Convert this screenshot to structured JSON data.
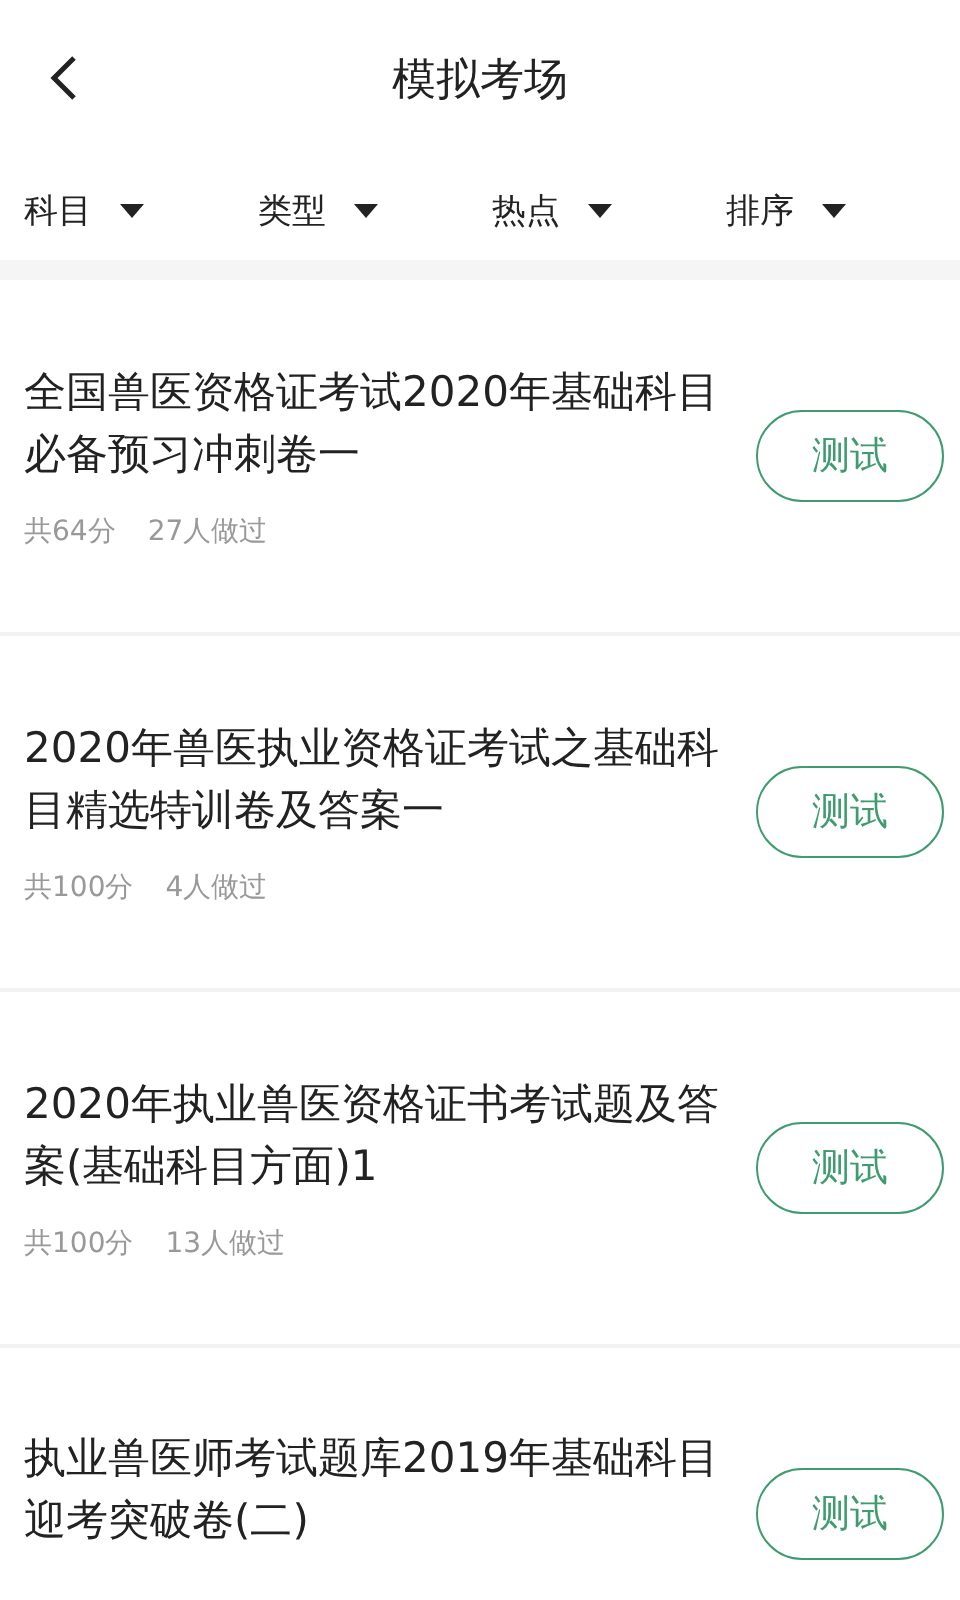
{
  "header": {
    "title": "模拟考场"
  },
  "filters": [
    {
      "label": "科目"
    },
    {
      "label": "类型"
    },
    {
      "label": "热点"
    },
    {
      "label": "排序"
    }
  ],
  "exams": [
    {
      "title": "全国兽医资格证考试2020年基础科目必备预习冲刺卷一",
      "score": "共64分",
      "takers": "27人做过",
      "button": "测试"
    },
    {
      "title": "2020年兽医执业资格证考试之基础科目精选特训卷及答案一",
      "score": "共100分",
      "takers": "4人做过",
      "button": "测试"
    },
    {
      "title": "2020年执业兽医资格证书考试题及答案(基础科目方面)1",
      "score": "共100分",
      "takers": "13人做过",
      "button": "测试"
    },
    {
      "title": "执业兽医师考试题库2019年基础科目迎考突破卷(二)",
      "button": "测试"
    }
  ]
}
